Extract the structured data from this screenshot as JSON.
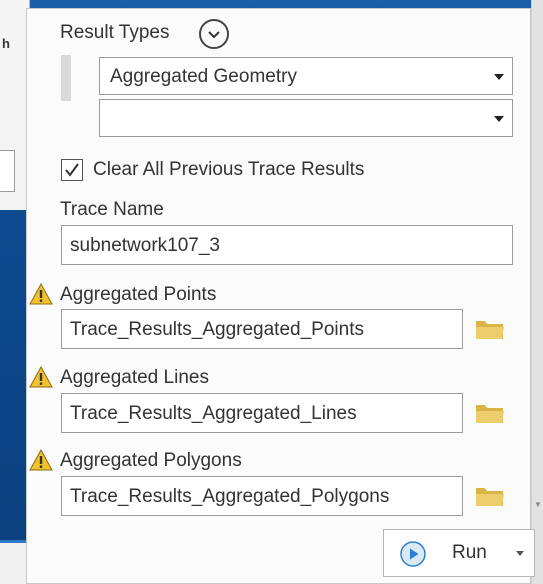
{
  "background": {
    "window_fragment_text": "h",
    "panel_controls": "▾ ▢ ✕"
  },
  "result_types": {
    "label": "Result Types",
    "select_1_value": "Aggregated Geometry",
    "select_2_value": ""
  },
  "clear_results": {
    "label": "Clear All Previous Trace Results",
    "checked": true
  },
  "trace_name": {
    "label": "Trace Name",
    "value": "subnetwork107_3"
  },
  "aggregated_points": {
    "label": "Aggregated Points",
    "value": "Trace_Results_Aggregated_Points"
  },
  "aggregated_lines": {
    "label": "Aggregated Lines",
    "value": "Trace_Results_Aggregated_Lines"
  },
  "aggregated_polygons": {
    "label": "Aggregated Polygons",
    "value": "Trace_Results_Aggregated_Polygons"
  },
  "run_button": {
    "label": "Run"
  },
  "colors": {
    "warning_yellow": "#f2c12e",
    "folder_yellow": "#e8c75a",
    "play_blue": "#2d7fd3",
    "desktop_blue": "#0d4a8f"
  },
  "icons": [
    "chevron-down-icon",
    "checkmark-icon",
    "warning-icon",
    "folder-icon",
    "play-icon"
  ]
}
